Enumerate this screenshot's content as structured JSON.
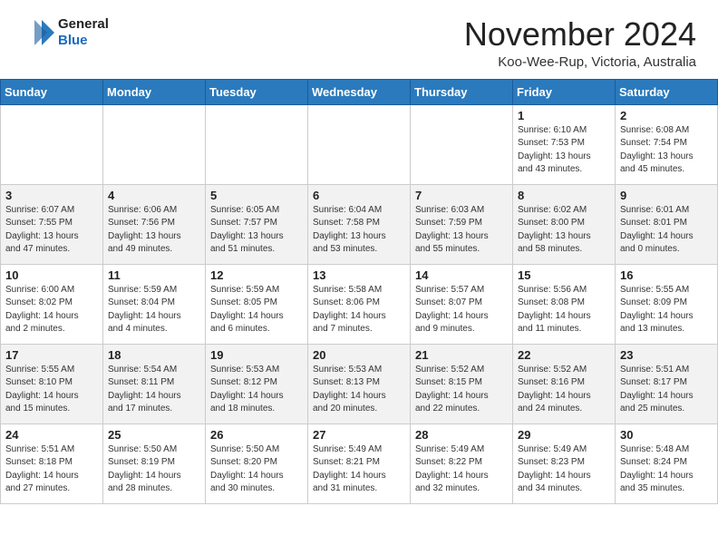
{
  "header": {
    "logo_line1": "General",
    "logo_line2": "Blue",
    "month": "November 2024",
    "location": "Koo-Wee-Rup, Victoria, Australia"
  },
  "days_of_week": [
    "Sunday",
    "Monday",
    "Tuesday",
    "Wednesday",
    "Thursday",
    "Friday",
    "Saturday"
  ],
  "weeks": [
    [
      {
        "day": "",
        "info": ""
      },
      {
        "day": "",
        "info": ""
      },
      {
        "day": "",
        "info": ""
      },
      {
        "day": "",
        "info": ""
      },
      {
        "day": "",
        "info": ""
      },
      {
        "day": "1",
        "info": "Sunrise: 6:10 AM\nSunset: 7:53 PM\nDaylight: 13 hours\nand 43 minutes."
      },
      {
        "day": "2",
        "info": "Sunrise: 6:08 AM\nSunset: 7:54 PM\nDaylight: 13 hours\nand 45 minutes."
      }
    ],
    [
      {
        "day": "3",
        "info": "Sunrise: 6:07 AM\nSunset: 7:55 PM\nDaylight: 13 hours\nand 47 minutes."
      },
      {
        "day": "4",
        "info": "Sunrise: 6:06 AM\nSunset: 7:56 PM\nDaylight: 13 hours\nand 49 minutes."
      },
      {
        "day": "5",
        "info": "Sunrise: 6:05 AM\nSunset: 7:57 PM\nDaylight: 13 hours\nand 51 minutes."
      },
      {
        "day": "6",
        "info": "Sunrise: 6:04 AM\nSunset: 7:58 PM\nDaylight: 13 hours\nand 53 minutes."
      },
      {
        "day": "7",
        "info": "Sunrise: 6:03 AM\nSunset: 7:59 PM\nDaylight: 13 hours\nand 55 minutes."
      },
      {
        "day": "8",
        "info": "Sunrise: 6:02 AM\nSunset: 8:00 PM\nDaylight: 13 hours\nand 58 minutes."
      },
      {
        "day": "9",
        "info": "Sunrise: 6:01 AM\nSunset: 8:01 PM\nDaylight: 14 hours\nand 0 minutes."
      }
    ],
    [
      {
        "day": "10",
        "info": "Sunrise: 6:00 AM\nSunset: 8:02 PM\nDaylight: 14 hours\nand 2 minutes."
      },
      {
        "day": "11",
        "info": "Sunrise: 5:59 AM\nSunset: 8:04 PM\nDaylight: 14 hours\nand 4 minutes."
      },
      {
        "day": "12",
        "info": "Sunrise: 5:59 AM\nSunset: 8:05 PM\nDaylight: 14 hours\nand 6 minutes."
      },
      {
        "day": "13",
        "info": "Sunrise: 5:58 AM\nSunset: 8:06 PM\nDaylight: 14 hours\nand 7 minutes."
      },
      {
        "day": "14",
        "info": "Sunrise: 5:57 AM\nSunset: 8:07 PM\nDaylight: 14 hours\nand 9 minutes."
      },
      {
        "day": "15",
        "info": "Sunrise: 5:56 AM\nSunset: 8:08 PM\nDaylight: 14 hours\nand 11 minutes."
      },
      {
        "day": "16",
        "info": "Sunrise: 5:55 AM\nSunset: 8:09 PM\nDaylight: 14 hours\nand 13 minutes."
      }
    ],
    [
      {
        "day": "17",
        "info": "Sunrise: 5:55 AM\nSunset: 8:10 PM\nDaylight: 14 hours\nand 15 minutes."
      },
      {
        "day": "18",
        "info": "Sunrise: 5:54 AM\nSunset: 8:11 PM\nDaylight: 14 hours\nand 17 minutes."
      },
      {
        "day": "19",
        "info": "Sunrise: 5:53 AM\nSunset: 8:12 PM\nDaylight: 14 hours\nand 18 minutes."
      },
      {
        "day": "20",
        "info": "Sunrise: 5:53 AM\nSunset: 8:13 PM\nDaylight: 14 hours\nand 20 minutes."
      },
      {
        "day": "21",
        "info": "Sunrise: 5:52 AM\nSunset: 8:15 PM\nDaylight: 14 hours\nand 22 minutes."
      },
      {
        "day": "22",
        "info": "Sunrise: 5:52 AM\nSunset: 8:16 PM\nDaylight: 14 hours\nand 24 minutes."
      },
      {
        "day": "23",
        "info": "Sunrise: 5:51 AM\nSunset: 8:17 PM\nDaylight: 14 hours\nand 25 minutes."
      }
    ],
    [
      {
        "day": "24",
        "info": "Sunrise: 5:51 AM\nSunset: 8:18 PM\nDaylight: 14 hours\nand 27 minutes."
      },
      {
        "day": "25",
        "info": "Sunrise: 5:50 AM\nSunset: 8:19 PM\nDaylight: 14 hours\nand 28 minutes."
      },
      {
        "day": "26",
        "info": "Sunrise: 5:50 AM\nSunset: 8:20 PM\nDaylight: 14 hours\nand 30 minutes."
      },
      {
        "day": "27",
        "info": "Sunrise: 5:49 AM\nSunset: 8:21 PM\nDaylight: 14 hours\nand 31 minutes."
      },
      {
        "day": "28",
        "info": "Sunrise: 5:49 AM\nSunset: 8:22 PM\nDaylight: 14 hours\nand 32 minutes."
      },
      {
        "day": "29",
        "info": "Sunrise: 5:49 AM\nSunset: 8:23 PM\nDaylight: 14 hours\nand 34 minutes."
      },
      {
        "day": "30",
        "info": "Sunrise: 5:48 AM\nSunset: 8:24 PM\nDaylight: 14 hours\nand 35 minutes."
      }
    ]
  ]
}
